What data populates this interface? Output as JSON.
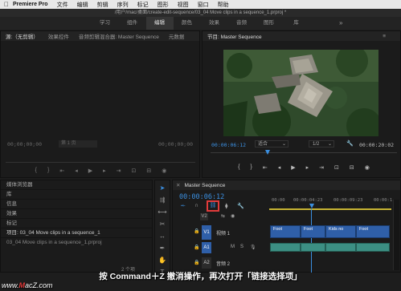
{
  "menubar": {
    "app": "Premiere Pro",
    "items": [
      "文件",
      "编辑",
      "剪辑",
      "序列",
      "标记",
      "图形",
      "视图",
      "窗口",
      "帮助"
    ]
  },
  "titlebar": {
    "path": "/用户/mac/桌面/create-edit-sequence/03_04 Move clips in a sequence_1.prproj *"
  },
  "workspaces": {
    "tabs": [
      "学习",
      "组件",
      "编辑",
      "颜色",
      "效果",
      "音频",
      "图形",
      "库"
    ],
    "active": "编辑"
  },
  "source": {
    "tabs": [
      "源:（无剪辑）",
      "效果控件",
      "音频剪辑混合器: Master Sequence",
      "元数据"
    ],
    "timecode_left": "00;00;00;00",
    "page": "第 1 页",
    "timecode_right": "00;00;00;00"
  },
  "program": {
    "tab": "节目: Master Sequence",
    "timecode": "00:00:06:12",
    "fit": "适合",
    "ratio": "1/2",
    "duration": "00:00:20:02"
  },
  "project": {
    "items": [
      "媒体浏览器",
      "库",
      "信息",
      "效果",
      "标记"
    ],
    "tab": "项目: 03_04 Move clips in a sequence_1",
    "file": "03_04 Move clips in a sequence_1.prproj",
    "count": "2 个项"
  },
  "timeline": {
    "tab": "Master Sequence",
    "timecode": "00:00:06:12",
    "ruler": [
      "00:00",
      "00:00:04:23",
      "00:00:09:23",
      "00:00:1"
    ],
    "tracks": {
      "v2": "V2",
      "v1": "V1",
      "v1_name": "视频 1",
      "a1": "A1",
      "a2": "A2",
      "a2_name": "音频 2"
    },
    "clips": [
      "Foot",
      "Foot",
      "Kids no",
      "Foot"
    ]
  },
  "caption": "按 Command＋Z 撤消操作，再次打开「链接选择项」",
  "watermark": {
    "prefix": "www.",
    "brand": "M",
    "rest": "acZ.com"
  }
}
